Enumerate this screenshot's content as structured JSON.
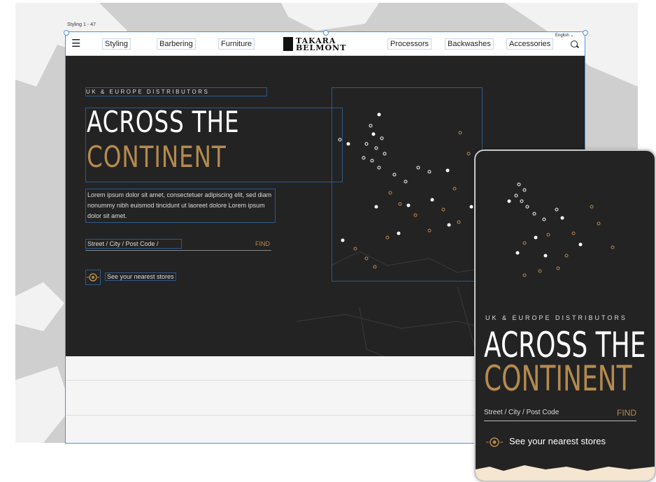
{
  "editor": {
    "frame_label": "Styling 1 - 47"
  },
  "nav": {
    "menu_icon": "hamburger-icon",
    "items": [
      "Styling",
      "Barbering",
      "Furniture",
      "Processors",
      "Backwashes",
      "Accessories"
    ],
    "logo_line1": "TAKARA",
    "logo_line2": "BELMONT",
    "language": "English",
    "search_icon": "search-icon"
  },
  "hero": {
    "eyebrow": "UK & EUROPE DISTRIBUTORS",
    "title_line1": "ACROSS THE",
    "title_line2": "CONTINENT",
    "body": "Lorem ipsum dolor sit amet, consectetuer adipiscing elit, sed diam nonummy nibh euismod tincidunt ut laoreet dolore Lorem ipsum dolor sit amet.",
    "search_placeholder": "Street / City / Post Code /",
    "find_label": "FIND",
    "nearest_label": "See your nearest stores",
    "accent_color": "#b58a4e"
  },
  "mobile": {
    "eyebrow": "UK & EUROPE DISTRIBUTORS",
    "title_line1": "ACROSS THE",
    "title_line2": "CONTINENT",
    "search_placeholder": "Street / City / Post Code",
    "find_label": "FIND",
    "nearest_label": "See your nearest stores"
  }
}
